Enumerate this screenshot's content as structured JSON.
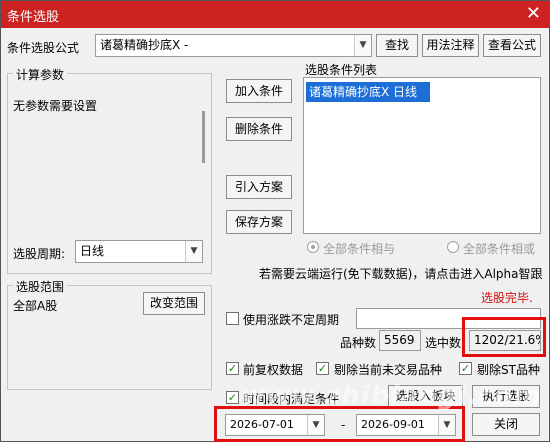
{
  "window": {
    "title": "条件选股",
    "close_glyph": "✕"
  },
  "formula": {
    "label": "条件选股公式",
    "value": "诸葛精确抄底X  -",
    "btn_find": "查找",
    "btn_usage": "用法注释",
    "btn_view": "查看公式"
  },
  "params": {
    "group_label": "计算参数",
    "text": "无参数需要设置",
    "period_label": "选股周期:",
    "period_value": "日线"
  },
  "actions": {
    "add": "加入条件",
    "remove": "删除条件",
    "import": "引入方案",
    "save": "保存方案"
  },
  "conditions": {
    "label": "选股条件列表",
    "items": [
      "诸葛精确抄底X  日线"
    ],
    "radio_and": "全部条件相与",
    "radio_or": "全部条件相或"
  },
  "cloud_note": "若需要云端运行(免下载数据)，请点击进入Alpha智跟",
  "status": "选股完毕.",
  "range": {
    "group_label": "选股范围",
    "value": "全部A股",
    "btn_change": "改变范围"
  },
  "options": {
    "uncertain_period": "使用涨跌不定周期",
    "forward_adjust": "前复权数据",
    "exclude_untraded": "剔除当前未交易品种",
    "exclude_st": "剔除ST品种",
    "time_period": "时间段内满足条件"
  },
  "stats": {
    "count_label": "品种数",
    "count_value": "5569",
    "selected_label": "选中数",
    "selected_value": "1202/21.6%"
  },
  "buttons": {
    "to_block": "选股入板块",
    "execute": "执行选股",
    "close": "关闭"
  },
  "dates": {
    "start": "2026-07-01",
    "separator": "-",
    "end": "2026-09-01"
  },
  "watermark": "www.zhibiaogi.com",
  "colors": {
    "title_bar": "#cc2222",
    "highlight": "#e01010",
    "status": "#d01010",
    "selection": "#1e6ed8"
  }
}
